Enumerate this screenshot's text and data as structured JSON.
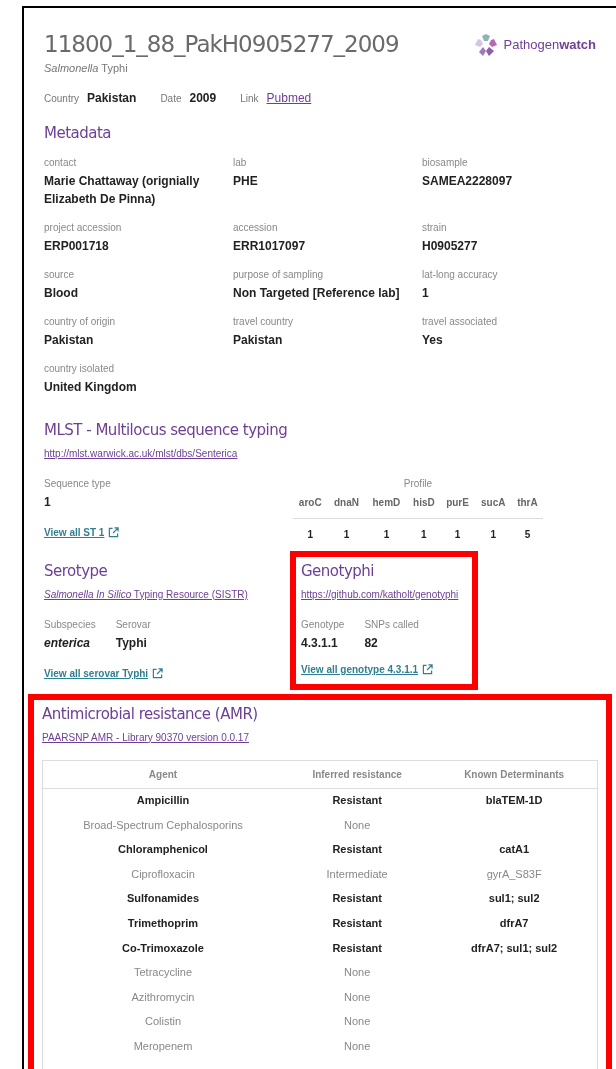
{
  "header": {
    "title": "11800_1_88_PakH0905277_2009",
    "organism": {
      "genus": "Salmonella",
      "species": "Typhi"
    },
    "logo": {
      "plain": "Pathogen",
      "bold": "watch"
    },
    "facts": [
      {
        "label": "Country",
        "value": "Pakistan",
        "kind": "text"
      },
      {
        "label": "Date",
        "value": "2009",
        "kind": "text"
      },
      {
        "label": "Link",
        "value": "Pubmed",
        "kind": "link"
      }
    ]
  },
  "metadata": {
    "heading": "Metadata",
    "fields": [
      {
        "label": "contact",
        "value": "Marie Chattaway (orignially Elizabeth De Pinna)"
      },
      {
        "label": "lab",
        "value": "PHE"
      },
      {
        "label": "biosample",
        "value": "SAMEA2228097"
      },
      {
        "label": "project accession",
        "value": "ERP001718"
      },
      {
        "label": "accession",
        "value": "ERR1017097"
      },
      {
        "label": "strain",
        "value": "H0905277"
      },
      {
        "label": "source",
        "value": "Blood"
      },
      {
        "label": "purpose of sampling",
        "value": "Non Targeted [Reference lab]"
      },
      {
        "label": "lat-long accuracy",
        "value": "1"
      },
      {
        "label": "country of origin",
        "value": "Pakistan"
      },
      {
        "label": "travel country",
        "value": "Pakistan"
      },
      {
        "label": "travel associated",
        "value": "Yes"
      },
      {
        "label": "country isolated",
        "value": "United Kingdom"
      }
    ]
  },
  "mlst": {
    "heading": "MLST - Multilocus sequence typing",
    "link": "http://mlst.warwick.ac.uk/mlst/dbs/Senterica",
    "sequence_type_label": "Sequence type",
    "sequence_type": "1",
    "view_link": "View all ST 1",
    "profile_label": "Profile",
    "profile": [
      {
        "gene": "aroC",
        "allele": "1"
      },
      {
        "gene": "dnaN",
        "allele": "1"
      },
      {
        "gene": "hemD",
        "allele": "1"
      },
      {
        "gene": "hisD",
        "allele": "1"
      },
      {
        "gene": "purE",
        "allele": "1"
      },
      {
        "gene": "sucA",
        "allele": "1"
      },
      {
        "gene": "thrA",
        "allele": "5"
      }
    ]
  },
  "serotype": {
    "heading": "Serotype",
    "link": "*Salmonella In Silico* Typing Resource (SISTR)",
    "fields": [
      {
        "label": "Subspecies",
        "value": "enterica",
        "italic": true
      },
      {
        "label": "Serovar",
        "value": "Typhi",
        "italic": false
      }
    ],
    "view_link": "View all serovar Typhi"
  },
  "genotyphi": {
    "heading": "Genotyphi",
    "highlighted": true,
    "link": "https://github.com/katholt/genotyphi",
    "fields": [
      {
        "label": "Genotype",
        "value": "4.3.1.1"
      },
      {
        "label": "SNPs called",
        "value": "82"
      }
    ],
    "view_link": "View all genotype 4.3.1.1"
  },
  "amr": {
    "heading": "Antimicrobial resistance (AMR)",
    "highlighted": true,
    "link": "PAARSNP AMR - Library 90370 version 0.0.17",
    "columns": [
      "Agent",
      "Inferred resistance",
      "Known Determinants"
    ],
    "rows": [
      {
        "agent": "Ampicillin",
        "resistance": "Resistant",
        "determinants": "blaTEM-1D",
        "kind": "resistant"
      },
      {
        "agent": "Broad-Spectrum Cephalosporins",
        "resistance": "None",
        "kind": "none"
      },
      {
        "agent": "Chloramphenicol",
        "resistance": "Resistant",
        "determinants": "catA1",
        "kind": "resistant"
      },
      {
        "agent": "Ciprofloxacin",
        "resistance": "Intermediate",
        "determinants": "gyrA_S83F",
        "kind": "intermediate"
      },
      {
        "agent": "Sulfonamides",
        "resistance": "Resistant",
        "determinants": "sul1; sul2",
        "kind": "resistant"
      },
      {
        "agent": "Trimethoprim",
        "resistance": "Resistant",
        "determinants": "dfrA7",
        "kind": "resistant"
      },
      {
        "agent": "Co-Trimoxazole",
        "resistance": "Resistant",
        "determinants": "dfrA7; sul1; sul2",
        "kind": "resistant"
      },
      {
        "agent": "Tetracycline",
        "resistance": "None",
        "kind": "none"
      },
      {
        "agent": "Azithromycin",
        "resistance": "None",
        "kind": "none"
      },
      {
        "agent": "Colistin",
        "resistance": "None",
        "kind": "none"
      },
      {
        "agent": "Meropenem",
        "resistance": "None",
        "kind": "none"
      }
    ]
  }
}
